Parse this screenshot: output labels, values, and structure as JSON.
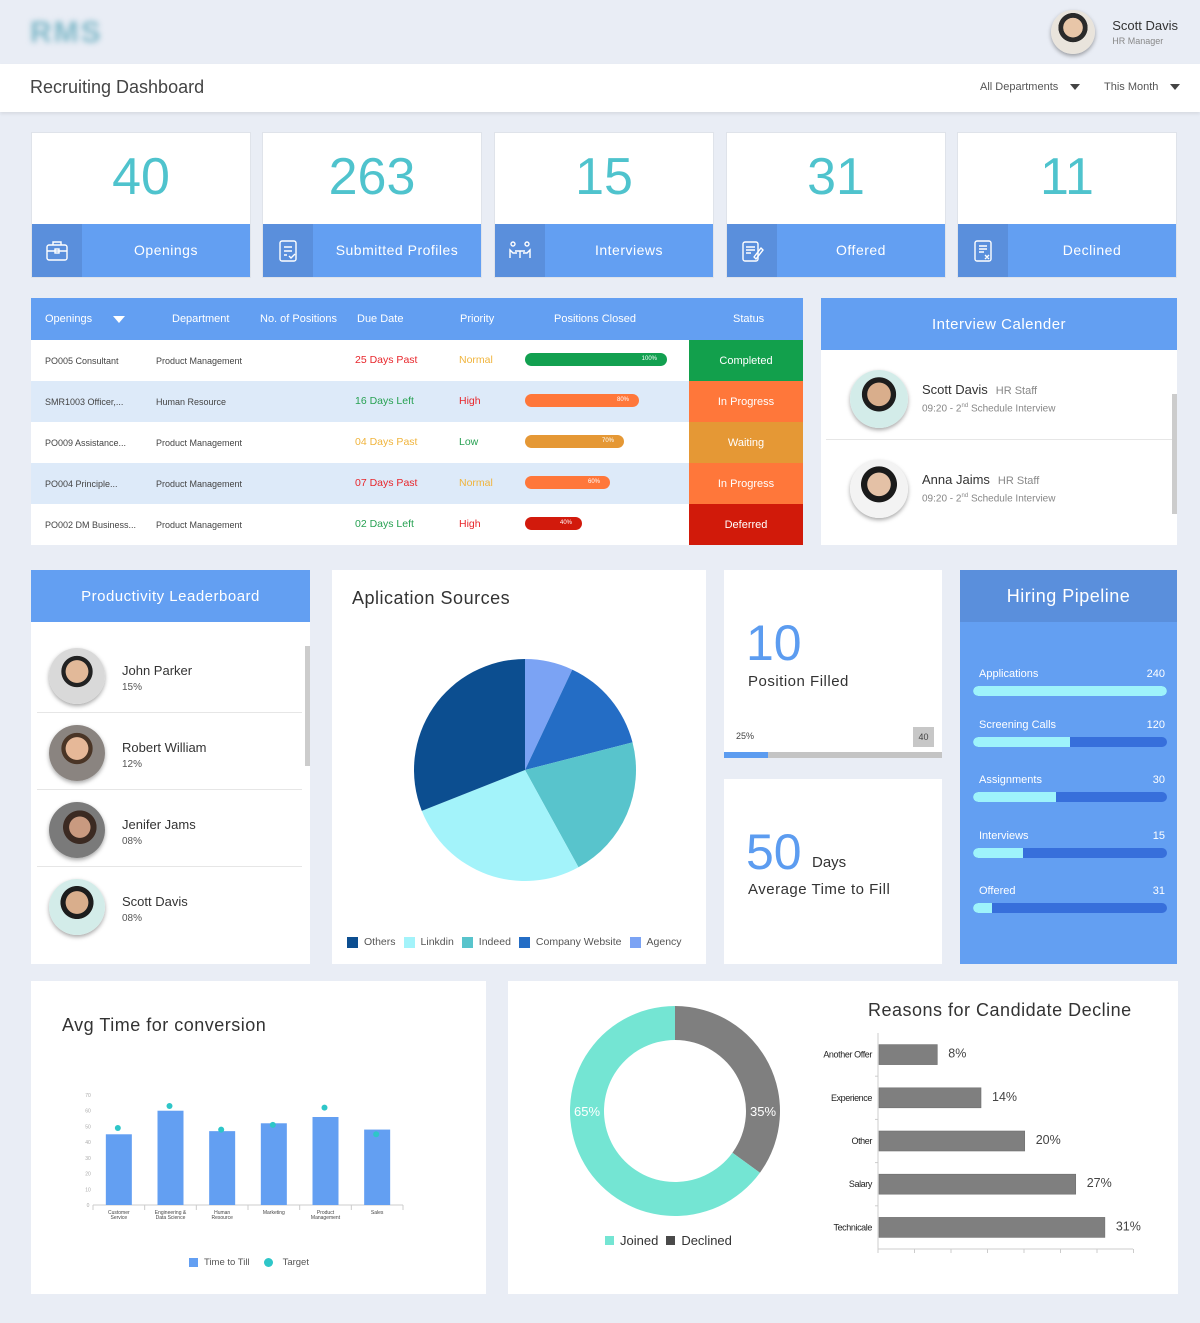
{
  "app": {
    "logo_text": "RMS"
  },
  "user": {
    "name": "Scott Davis",
    "role": "HR Manager"
  },
  "header": {
    "title": "Recruiting Dashboard",
    "department_filter": "All Departments",
    "period_filter": "This Month"
  },
  "kpis": [
    {
      "value": "40",
      "label": "Openings",
      "icon": "briefcase-icon"
    },
    {
      "value": "263",
      "label": "Submitted Profiles",
      "icon": "document-check-icon"
    },
    {
      "value": "15",
      "label": "Interviews",
      "icon": "interview-icon"
    },
    {
      "value": "31",
      "label": "Offered",
      "icon": "offer-letter-icon"
    },
    {
      "value": "11",
      "label": "Declined",
      "icon": "document-x-icon"
    }
  ],
  "openings_table": {
    "columns": [
      "Openings",
      "Department",
      "No. of Positions",
      "Due Date",
      "Priority",
      "Positions Closed",
      "Status"
    ],
    "rows": [
      {
        "opening": "PO005 Consultant",
        "department": "Product Management",
        "positions": "",
        "due": "25 Days Past",
        "due_color": "#e8262b",
        "priority": "Normal",
        "priority_color": "#f0b43c",
        "closed_pct": 100,
        "closed_label": "100%",
        "bar_color": "#12a050",
        "status": "Completed",
        "status_color": "#12a04c"
      },
      {
        "opening": "SMR1003 Officer,...",
        "department": "Human Resource",
        "positions": "",
        "due": "16 Days Left",
        "due_color": "#27a152",
        "priority": "High",
        "priority_color": "#e8262b",
        "closed_pct": 80,
        "closed_label": "80%",
        "bar_color": "#ff773a",
        "status": "In Progress",
        "status_color": "#ff773a"
      },
      {
        "opening": "PO009 Assistance...",
        "department": "Product Management",
        "positions": "",
        "due": "04 Days Past",
        "due_color": "#f0b43c",
        "priority": "Low",
        "priority_color": "#27a152",
        "closed_pct": 70,
        "closed_label": "70%",
        "bar_color": "#e59835",
        "status": "Waiting",
        "status_color": "#e59835"
      },
      {
        "opening": "PO004 Principle...",
        "department": "Product Management",
        "positions": "",
        "due": "07 Days Past",
        "due_color": "#e8262b",
        "priority": "Normal",
        "priority_color": "#f0b43c",
        "closed_pct": 60,
        "closed_label": "60%",
        "bar_color": "#ff773a",
        "status": "In Progress",
        "status_color": "#ff773a"
      },
      {
        "opening": "PO002 DM Business...",
        "department": "Product Management",
        "positions": "",
        "due": "02 Days Left",
        "due_color": "#27a152",
        "priority": "High",
        "priority_color": "#e8262b",
        "closed_pct": 40,
        "closed_label": "40%",
        "bar_color": "#d21a0c",
        "status": "Deferred",
        "status_color": "#d11a0a"
      }
    ]
  },
  "interview_calendar": {
    "title": "Interview Calender",
    "items": [
      {
        "name": "Scott Davis",
        "role": "HR Staff",
        "time": "09:20 - 2",
        "ordinal": "nd",
        "event": " Schedule Interview"
      },
      {
        "name": "Anna Jaims",
        "role": "HR Staff",
        "time": "09:20 - 2",
        "ordinal": "nd",
        "event": " Schedule Interview"
      }
    ]
  },
  "leaderboard": {
    "title": "Productivity Leaderboard",
    "items": [
      {
        "name": "John Parker",
        "pct": "15%"
      },
      {
        "name": "Robert William",
        "pct": "12%"
      },
      {
        "name": "Jenifer Jams",
        "pct": "08%"
      },
      {
        "name": "Scott Davis",
        "pct": "08%"
      }
    ]
  },
  "position_filled": {
    "value": "10",
    "label": "Position Filled",
    "pct_label": "25%",
    "progress": 0.25,
    "total": "40"
  },
  "avg_time_to_fill": {
    "value": "50",
    "unit": "Days",
    "label": "Average Time to Fill"
  },
  "hiring_pipeline": {
    "title": "Hiring Pipeline",
    "items": [
      {
        "label": "Applications",
        "value": "240",
        "fill": 1.0
      },
      {
        "label": "Screening Calls",
        "value": "120",
        "fill": 0.5
      },
      {
        "label": "Assignments",
        "value": "30",
        "fill": 0.43
      },
      {
        "label": "Interviews",
        "value": "15",
        "fill": 0.26
      },
      {
        "label": "Offered",
        "value": "31",
        "fill": 0.1
      }
    ]
  },
  "chart_data": [
    {
      "type": "pie",
      "title": "Aplication Sources",
      "categories": [
        "Agency",
        "Company Website",
        "Indeed",
        "Linkdin",
        "Others"
      ],
      "values": [
        7,
        14,
        21,
        27,
        31
      ],
      "colors": [
        "#7ba3f4",
        "#246dc5",
        "#58c4cc",
        "#a3f3fa",
        "#0c4e90"
      ],
      "legend": [
        {
          "label": "Others",
          "color": "#0c4e90"
        },
        {
          "label": "Linkdin",
          "color": "#a3f3fa"
        },
        {
          "label": "Indeed",
          "color": "#58c4cc"
        },
        {
          "label": "Company Website",
          "color": "#246dc5"
        },
        {
          "label": "Agency",
          "color": "#7ba3f4"
        }
      ],
      "legend_position": "bottom"
    },
    {
      "type": "bar",
      "title": "Avg Time for conversion",
      "categories": [
        [
          "Customer",
          "Service"
        ],
        [
          "Engineering &",
          "Data Science"
        ],
        [
          "Human",
          "Resource"
        ],
        [
          "Marketing"
        ],
        [
          "Product",
          "Management"
        ],
        [
          "Sales"
        ]
      ],
      "series": [
        {
          "name": "Time to Till",
          "type": "bar",
          "color": "#639ff2",
          "values": [
            45,
            60,
            47,
            52,
            56,
            48
          ]
        },
        {
          "name": "Target",
          "type": "scatter",
          "color": "#2ec6c8",
          "values": [
            49,
            63,
            48,
            51,
            62,
            45
          ]
        }
      ],
      "yticks": [
        0,
        10,
        20,
        30,
        40,
        50,
        60,
        70
      ],
      "ylim": [
        0,
        70
      ],
      "xlabel": "",
      "ylabel": "",
      "legend_position": "bottom"
    },
    {
      "type": "pie",
      "subtype": "donut",
      "title": "",
      "categories": [
        "Joined",
        "Declined"
      ],
      "values": [
        65,
        35
      ],
      "labels": [
        "65%",
        "35%"
      ],
      "colors": [
        "#74e5d3",
        "#7f7f7f"
      ],
      "legend_colors": [
        "#74e5d3",
        "#4a4a4a"
      ],
      "legend_position": "bottom"
    },
    {
      "type": "bar",
      "orientation": "horizontal",
      "title": "Reasons for Candidate Decline",
      "categories": [
        "Another Offer",
        "Experience",
        "Other",
        "Salary",
        "Technicale"
      ],
      "values": [
        8,
        14,
        20,
        27,
        31
      ],
      "labels": [
        "8%",
        "14%",
        "20%",
        "27%",
        "31%"
      ],
      "color": "#7f7f7f",
      "xlim": [
        0,
        35
      ]
    }
  ]
}
